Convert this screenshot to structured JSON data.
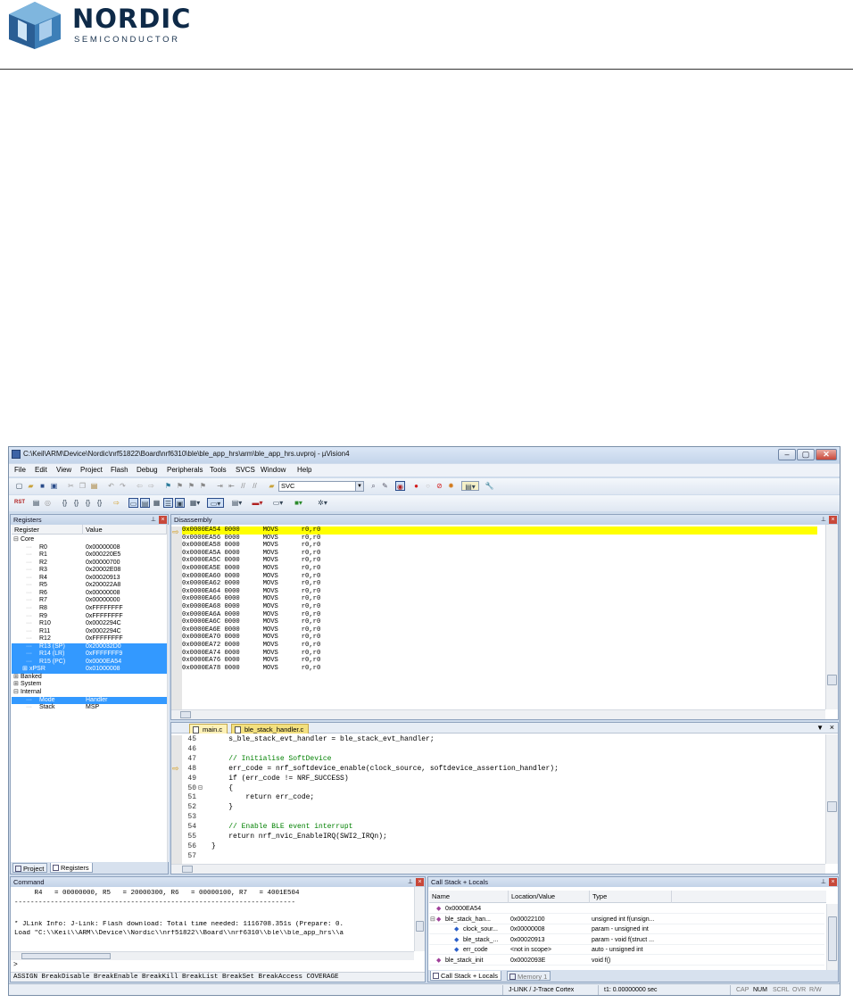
{
  "logo": {
    "name": "NORDIC",
    "subtitle": "SEMICONDUCTOR"
  },
  "window": {
    "title": "C:\\Keil\\ARM\\Device\\Nordic\\nrf51822\\Board\\nrf6310\\ble\\ble_app_hrs\\arm\\ble_app_hrs.uvproj - µVision4",
    "controls": {
      "minimize": "–",
      "maximize": "▢",
      "close": "✕"
    }
  },
  "menu": [
    "File",
    "Edit",
    "View",
    "Project",
    "Flash",
    "Debug",
    "Peripherals",
    "Tools",
    "SVCS",
    "Window",
    "Help"
  ],
  "toolbar": {
    "target_combo": "SVC",
    "rst_label": "RST"
  },
  "registers": {
    "title": "Registers",
    "columns": [
      "Register",
      "Value"
    ],
    "rows": [
      {
        "name": "Core",
        "value": "",
        "expander": "⊟",
        "selected": false,
        "indent": 0
      },
      {
        "name": "R0",
        "value": "0x00000008",
        "expander": "",
        "selected": false,
        "indent": 2
      },
      {
        "name": "R1",
        "value": "0x000220E5",
        "expander": "",
        "selected": false,
        "indent": 2
      },
      {
        "name": "R2",
        "value": "0x00000700",
        "expander": "",
        "selected": false,
        "indent": 2
      },
      {
        "name": "R3",
        "value": "0x20002E08",
        "expander": "",
        "selected": false,
        "indent": 2
      },
      {
        "name": "R4",
        "value": "0x00020913",
        "expander": "",
        "selected": false,
        "indent": 2
      },
      {
        "name": "R5",
        "value": "0x200022A8",
        "expander": "",
        "selected": false,
        "indent": 2
      },
      {
        "name": "R6",
        "value": "0x00000008",
        "expander": "",
        "selected": false,
        "indent": 2
      },
      {
        "name": "R7",
        "value": "0x00000000",
        "expander": "",
        "selected": false,
        "indent": 2
      },
      {
        "name": "R8",
        "value": "0xFFFFFFFF",
        "expander": "",
        "selected": false,
        "indent": 2
      },
      {
        "name": "R9",
        "value": "0xFFFFFFFF",
        "expander": "",
        "selected": false,
        "indent": 2
      },
      {
        "name": "R10",
        "value": "0x0002294C",
        "expander": "",
        "selected": false,
        "indent": 2
      },
      {
        "name": "R11",
        "value": "0x0002294C",
        "expander": "",
        "selected": false,
        "indent": 2
      },
      {
        "name": "R12",
        "value": "0xFFFFFFFF",
        "expander": "",
        "selected": false,
        "indent": 2
      },
      {
        "name": "R13 (SP)",
        "value": "0x200032D0",
        "expander": "",
        "selected": true,
        "indent": 2
      },
      {
        "name": "R14 (LR)",
        "value": "0xFFFFFFF9",
        "expander": "",
        "selected": true,
        "indent": 2
      },
      {
        "name": "R15 (PC)",
        "value": "0x0000EA54",
        "expander": "",
        "selected": true,
        "indent": 2
      },
      {
        "name": "xPSR",
        "value": "0x01000008",
        "expander": "⊞",
        "selected": true,
        "indent": 1
      },
      {
        "name": "Banked",
        "value": "",
        "expander": "⊞",
        "selected": false,
        "indent": 0
      },
      {
        "name": "System",
        "value": "",
        "expander": "⊞",
        "selected": false,
        "indent": 0
      },
      {
        "name": "Internal",
        "value": "",
        "expander": "⊟",
        "selected": false,
        "indent": 0
      },
      {
        "name": "Mode",
        "value": "Handler",
        "expander": "",
        "selected": true,
        "indent": 2
      },
      {
        "name": "Stack",
        "value": "MSP",
        "expander": "",
        "selected": false,
        "indent": 2
      }
    ],
    "tabs": [
      "Project",
      "Registers"
    ]
  },
  "disassembly": {
    "title": "Disassembly",
    "rows": [
      "0x0000EA54 0000      MOVS      r0,r0",
      "0x0000EA56 0000      MOVS      r0,r0",
      "0x0000EA58 0000      MOVS      r0,r0",
      "0x0000EA5A 0000      MOVS      r0,r0",
      "0x0000EA5C 0000      MOVS      r0,r0",
      "0x0000EA5E 0000      MOVS      r0,r0",
      "0x0000EA60 0000      MOVS      r0,r0",
      "0x0000EA62 0000      MOVS      r0,r0",
      "0x0000EA64 0000      MOVS      r0,r0",
      "0x0000EA66 0000      MOVS      r0,r0",
      "0x0000EA68 0000      MOVS      r0,r0",
      "0x0000EA6A 0000      MOVS      r0,r0",
      "0x0000EA6C 0000      MOVS      r0,r0",
      "0x0000EA6E 0000      MOVS      r0,r0",
      "0x0000EA70 0000      MOVS      r0,r0",
      "0x0000EA72 0000      MOVS      r0,r0",
      "0x0000EA74 0000      MOVS      r0,r0",
      "0x0000EA76 0000      MOVS      r0,r0",
      "0x0000EA78 0000      MOVS      r0,r0"
    ]
  },
  "editor": {
    "tabs": [
      "main.c",
      "ble_stack_handler.c"
    ],
    "lines": [
      {
        "ln": "45",
        "code": "    s_ble_stack_evt_handler = ble_stack_evt_handler;",
        "cls": ""
      },
      {
        "ln": "46",
        "code": "",
        "cls": ""
      },
      {
        "ln": "47",
        "code": "    // Initialise SoftDevice",
        "cls": "cmt"
      },
      {
        "ln": "48",
        "code": "    err_code = nrf_softdevice_enable(clock_source, softdevice_assertion_handler);",
        "cls": ""
      },
      {
        "ln": "49",
        "code": "    if (err_code != NRF_SUCCESS)",
        "cls": ""
      },
      {
        "ln": "50",
        "code": "    {",
        "cls": ""
      },
      {
        "ln": "51",
        "code": "        return err_code;",
        "cls": ""
      },
      {
        "ln": "52",
        "code": "    }",
        "cls": ""
      },
      {
        "ln": "53",
        "code": "",
        "cls": ""
      },
      {
        "ln": "54",
        "code": "    // Enable BLE event interrupt",
        "cls": "cmt"
      },
      {
        "ln": "55",
        "code": "    return nrf_nvic_EnableIRQ(SWI2_IRQn);",
        "cls": ""
      },
      {
        "ln": "56",
        "code": "}",
        "cls": ""
      },
      {
        "ln": "57",
        "code": "",
        "cls": ""
      }
    ]
  },
  "command": {
    "title": "Command",
    "lines": [
      "     R4   = 00000000, R5   = 20000300, R6   = 00000100, R7   = 4001E504",
      "----------------------------------------------------------------------",
      "",
      "* JLink Info: J-Link: Flash download: Total time needed: 1116708.351s (Prepare: 0.",
      "Load \"C:\\\\Keil\\\\ARM\\\\Device\\\\Nordic\\\\nrf51822\\\\Board\\\\nrf6310\\\\ble\\\\ble_app_hrs\\\\a"
    ],
    "prompt": ">",
    "hint": "ASSIGN BreakDisable BreakEnable BreakKill BreakList BreakSet BreakAccess COVERAGE"
  },
  "callstack": {
    "title": "Call Stack + Locals",
    "columns": [
      "Name",
      "Location/Value",
      "Type"
    ],
    "rows": [
      {
        "name": "0x0000EA54",
        "loc": "",
        "type": "",
        "indent": 1
      },
      {
        "name": "ble_stack_han...",
        "loc": "0x00022100",
        "type": "unsigned int f(unsign...",
        "indent": 1
      },
      {
        "name": "clock_sour...",
        "loc": "0x00000008",
        "type": "param - unsigned int",
        "indent": 2
      },
      {
        "name": "ble_stack_...",
        "loc": "0x00020913",
        "type": "param - void f(struct ...",
        "indent": 2
      },
      {
        "name": "err_code",
        "loc": "<not in scope>",
        "type": "auto - unsigned int",
        "indent": 2
      },
      {
        "name": "ble_stack_init",
        "loc": "0x0002093E",
        "type": "void f()",
        "indent": 1
      }
    ],
    "tabs": [
      "Call Stack + Locals",
      "Memory 1"
    ]
  },
  "statusbar": {
    "debugger": "J-LINK / J-Trace Cortex",
    "time": "t1: 0.00000000 sec",
    "flags": [
      "CAP",
      "NUM",
      "SCRL",
      "OVR",
      "R/W"
    ]
  },
  "colors": {
    "selection": "#3399ff",
    "current_line": "#ffff00",
    "accent": "#0e2a48"
  }
}
